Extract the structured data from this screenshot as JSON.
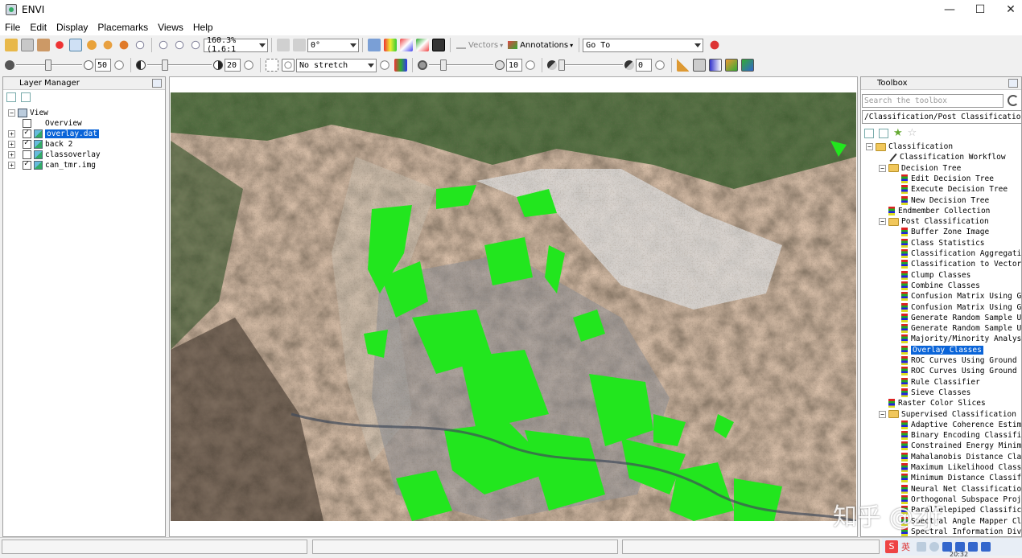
{
  "window": {
    "title": "ENVI",
    "controls": {
      "minimize": "—",
      "maximize": "☐",
      "close": "✕"
    }
  },
  "menu": [
    "File",
    "Edit",
    "Display",
    "Placemarks",
    "Views",
    "Help"
  ],
  "toolbar1": {
    "zoom_value": "160.3% (1.6:1",
    "rotation_value": "0°",
    "vectors_label": "Vectors",
    "annotations_label": "Annotations",
    "goto_value": "Go To"
  },
  "toolbar2": {
    "brightness_value": "50",
    "contrast_value": "20",
    "stretch_value": "No stretch",
    "sharpen_value": "10",
    "transparency_value": "0"
  },
  "layer_manager": {
    "title": "Layer Manager",
    "root": "View",
    "overview": "Overview",
    "layers": [
      {
        "name": "overlay.dat",
        "checked": true,
        "selected": true
      },
      {
        "name": "back 2",
        "checked": true,
        "selected": false
      },
      {
        "name": "classoverlay",
        "checked": false,
        "selected": false
      },
      {
        "name": "can_tmr.img",
        "checked": true,
        "selected": false
      }
    ]
  },
  "toolbox": {
    "title": "Toolbox",
    "search_placeholder": "Search the toolbox",
    "path": "/Classification/Post Classification/Over",
    "items": [
      {
        "label": "Classification",
        "level": 0,
        "kind": "folder",
        "expander": "−"
      },
      {
        "label": "Classification Workflow",
        "level": 1,
        "kind": "wand"
      },
      {
        "label": "Decision Tree",
        "level": 1,
        "kind": "folder",
        "expander": "−"
      },
      {
        "label": "Edit Decision Tree",
        "level": 2,
        "kind": "tool"
      },
      {
        "label": "Execute Decision Tree",
        "level": 2,
        "kind": "tool"
      },
      {
        "label": "New Decision Tree",
        "level": 2,
        "kind": "tool"
      },
      {
        "label": "Endmember Collection",
        "level": 1,
        "kind": "tool"
      },
      {
        "label": "Post Classification",
        "level": 1,
        "kind": "folder",
        "expander": "−"
      },
      {
        "label": "Buffer Zone Image",
        "level": 2,
        "kind": "tool"
      },
      {
        "label": "Class Statistics",
        "level": 2,
        "kind": "tool"
      },
      {
        "label": "Classification Aggregation",
        "level": 2,
        "kind": "tool"
      },
      {
        "label": "Classification to Vector",
        "level": 2,
        "kind": "tool"
      },
      {
        "label": "Clump Classes",
        "level": 2,
        "kind": "tool"
      },
      {
        "label": "Combine Classes",
        "level": 2,
        "kind": "tool"
      },
      {
        "label": "Confusion Matrix Using Grou",
        "level": 2,
        "kind": "tool"
      },
      {
        "label": "Confusion Matrix Using Grou",
        "level": 2,
        "kind": "tool"
      },
      {
        "label": "Generate Random Sample Usin",
        "level": 2,
        "kind": "tool"
      },
      {
        "label": "Generate Random Sample Usin",
        "level": 2,
        "kind": "tool"
      },
      {
        "label": "Majority/Minority Analysis",
        "level": 2,
        "kind": "tool"
      },
      {
        "label": "Overlay Classes",
        "level": 2,
        "kind": "tool",
        "selected": true
      },
      {
        "label": "ROC Curves Using Ground Tru",
        "level": 2,
        "kind": "tool"
      },
      {
        "label": "ROC Curves Using Ground Tru",
        "level": 2,
        "kind": "tool"
      },
      {
        "label": "Rule Classifier",
        "level": 2,
        "kind": "tool"
      },
      {
        "label": "Sieve Classes",
        "level": 2,
        "kind": "tool"
      },
      {
        "label": "Raster Color Slices",
        "level": 1,
        "kind": "tool"
      },
      {
        "label": "Supervised Classification",
        "level": 1,
        "kind": "folder",
        "expander": "−"
      },
      {
        "label": "Adaptive Coherence Estimato",
        "level": 2,
        "kind": "tool"
      },
      {
        "label": "Binary Encoding Classificat",
        "level": 2,
        "kind": "tool"
      },
      {
        "label": "Constrained Energy Minimiza",
        "level": 2,
        "kind": "tool"
      },
      {
        "label": "Mahalanobis Distance Classi",
        "level": 2,
        "kind": "tool"
      },
      {
        "label": "Maximum Likelihood Classifi",
        "level": 2,
        "kind": "tool"
      },
      {
        "label": "Minimum Distance Classifica",
        "level": 2,
        "kind": "tool"
      },
      {
        "label": "Neural Net Classification",
        "level": 2,
        "kind": "tool"
      },
      {
        "label": "Orthogonal Subspace Project",
        "level": 2,
        "kind": "tool"
      },
      {
        "label": "Parallelepiped Classificati",
        "level": 2,
        "kind": "tool"
      },
      {
        "label": "Spectral Angle Mapper Class",
        "level": 2,
        "kind": "tool"
      },
      {
        "label": "Spectral Information Diver",
        "level": 2,
        "kind": "tool"
      }
    ]
  },
  "watermark": "知乎 @zjf",
  "taskbar": {
    "ime": "英",
    "clock": "20:32"
  }
}
